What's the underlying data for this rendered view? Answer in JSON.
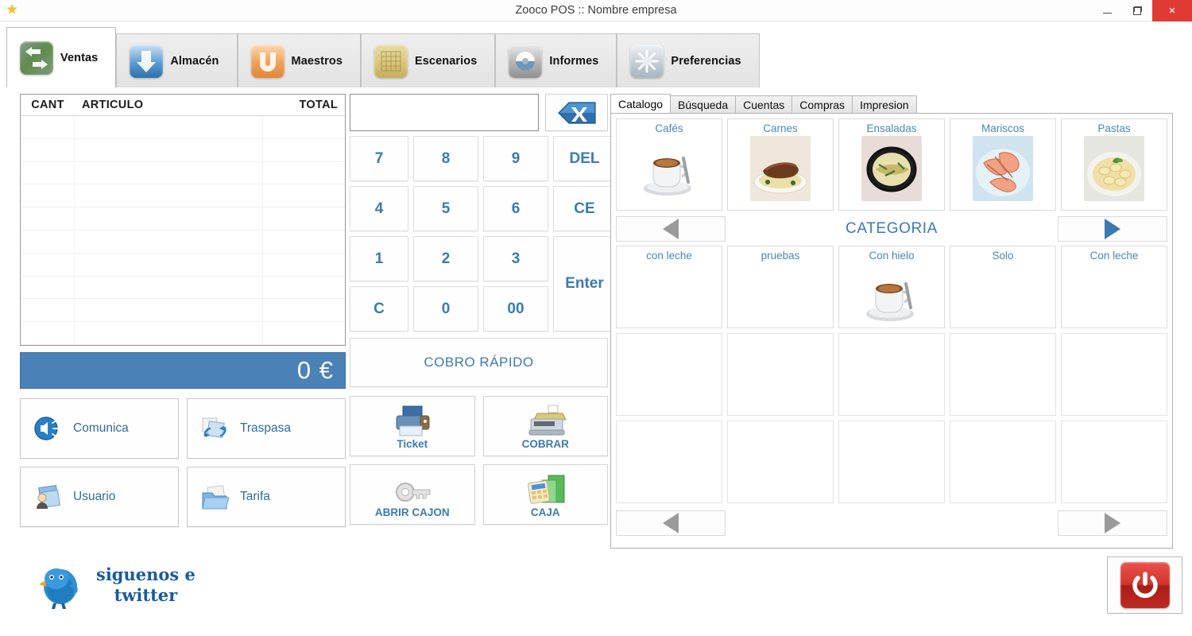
{
  "window": {
    "title": "Zooco POS :: Nombre empresa",
    "star_icon": "star-icon",
    "minimize_label": "",
    "restore_label": "",
    "close_label": "×"
  },
  "ribbon": {
    "tabs": [
      {
        "label": "Ventas",
        "icon": "sales-arrows-icon",
        "active": true
      },
      {
        "label": "Almacén",
        "icon": "download-arrow-icon",
        "active": false
      },
      {
        "label": "Maestros",
        "icon": "magnet-icon",
        "active": false
      },
      {
        "label": "Escenarios",
        "icon": "grid-table-icon",
        "active": false
      },
      {
        "label": "Informes",
        "icon": "report-disc-icon",
        "active": false
      },
      {
        "label": "Preferencias",
        "icon": "gear-snowflake-icon",
        "active": false
      }
    ]
  },
  "ticket": {
    "columns": [
      "CANT",
      "ARTICULO",
      "TOTAL"
    ],
    "rows": [],
    "empty_row_count": 10,
    "total_value": "0 €",
    "total_bar_color": "#4a82b8"
  },
  "left_buttons": [
    {
      "label": "Comunica",
      "icon": "speaker-icon"
    },
    {
      "label": "Traspasa",
      "icon": "transfer-folders-icon"
    },
    {
      "label": "Usuario",
      "icon": "user-folder-icon"
    },
    {
      "label": "Tarifa",
      "icon": "folder-icon"
    }
  ],
  "keypad": {
    "display_value": "",
    "backspace_icon": "backspace-icon",
    "keys": [
      "7",
      "8",
      "9",
      "DEL",
      "4",
      "5",
      "6",
      "CE",
      "1",
      "2",
      "3",
      "Enter",
      "C",
      "0",
      "00"
    ],
    "quick_charge_label": "COBRO RÁPIDO",
    "key_color": "#3c7ab0"
  },
  "mid_buttons": [
    {
      "label": "Ticket",
      "icon": "printer-icon"
    },
    {
      "label": "COBRAR",
      "icon": "cash-register-icon"
    },
    {
      "label": "ABRIR CAJON",
      "icon": "key-icon"
    },
    {
      "label": "CAJA",
      "icon": "calculator-folder-icon"
    }
  ],
  "catalog_panel": {
    "tabs": [
      {
        "label": "Catalogo",
        "active": true
      },
      {
        "label": "Búsqueda",
        "active": false
      },
      {
        "label": "Cuentas",
        "active": false
      },
      {
        "label": "Compras",
        "active": false
      },
      {
        "label": "Impresion",
        "active": false
      }
    ],
    "categories": [
      {
        "label": "Cafés",
        "thumb": "coffee-cup-photo"
      },
      {
        "label": "Carnes",
        "thumb": "steak-photo"
      },
      {
        "label": "Ensaladas",
        "thumb": "salad-bowl-photo"
      },
      {
        "label": "Mariscos",
        "thumb": "shrimp-photo"
      },
      {
        "label": "Pastas",
        "thumb": "pasta-photo"
      }
    ],
    "category_nav": {
      "label": "CATEGORIA",
      "prev_enabled": false,
      "next_enabled": true
    },
    "products": [
      {
        "label": "con leche",
        "thumb": ""
      },
      {
        "label": "pruebas",
        "thumb": ""
      },
      {
        "label": "Con hielo",
        "thumb": "coffee-cup-photo"
      },
      {
        "label": "Solo",
        "thumb": ""
      },
      {
        "label": "Con leche",
        "thumb": ""
      }
    ],
    "empty_rows": 2,
    "empty_cols": 5,
    "product_nav": {
      "prev_enabled": false,
      "next_enabled": false
    }
  },
  "footer": {
    "twitter_line1": "siguenos e",
    "twitter_line2": "twitter",
    "twitter_icon": "twitter-bird-icon",
    "power_icon": "power-icon"
  }
}
